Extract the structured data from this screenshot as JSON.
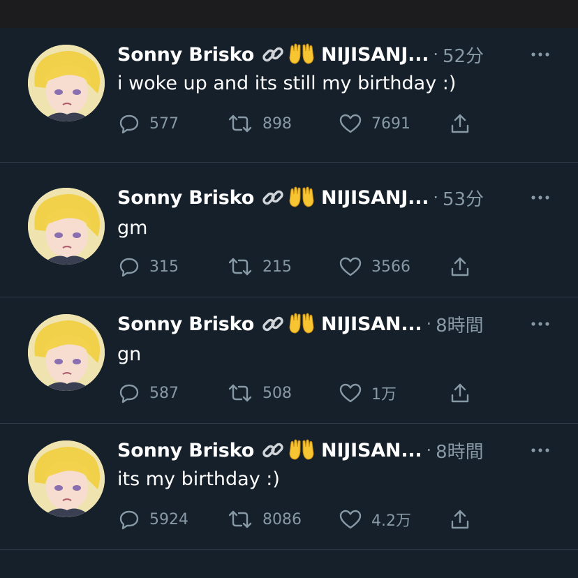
{
  "tweets": [
    {
      "author": "Sonny Brisko",
      "handle": "NIJISANJ...",
      "time": "52分",
      "text": "i woke up and its still my birthday :)",
      "replies": "577",
      "retweets": "898",
      "likes": "7691"
    },
    {
      "author": "Sonny Brisko",
      "handle": "NIJISANJ...",
      "time": "53分",
      "text": "gm",
      "replies": "315",
      "retweets": "215",
      "likes": "3566"
    },
    {
      "author": "Sonny Brisko",
      "handle": "NIJISAN...",
      "time": "8時間",
      "text": "gn",
      "replies": "587",
      "retweets": "508",
      "likes": "1万"
    },
    {
      "author": "Sonny Brisko",
      "handle": "NIJISAN...",
      "time": "8時間",
      "text": "its my birthday :)",
      "replies": "5924",
      "retweets": "8086",
      "likes": "4.2万"
    }
  ],
  "separator": "·",
  "icons": {
    "name_badges": [
      "link-icon",
      "raised-hands-emoji"
    ],
    "reply": "reply-icon",
    "retweet": "retweet-icon",
    "like": "heart-icon",
    "share": "share-icon",
    "more": "more-options-icon"
  },
  "colors": {
    "background": "#15202b",
    "text": "#ffffff",
    "secondary": "#8899a6",
    "divider": "#2f3b47",
    "top_bar": "#1c1c1e"
  }
}
